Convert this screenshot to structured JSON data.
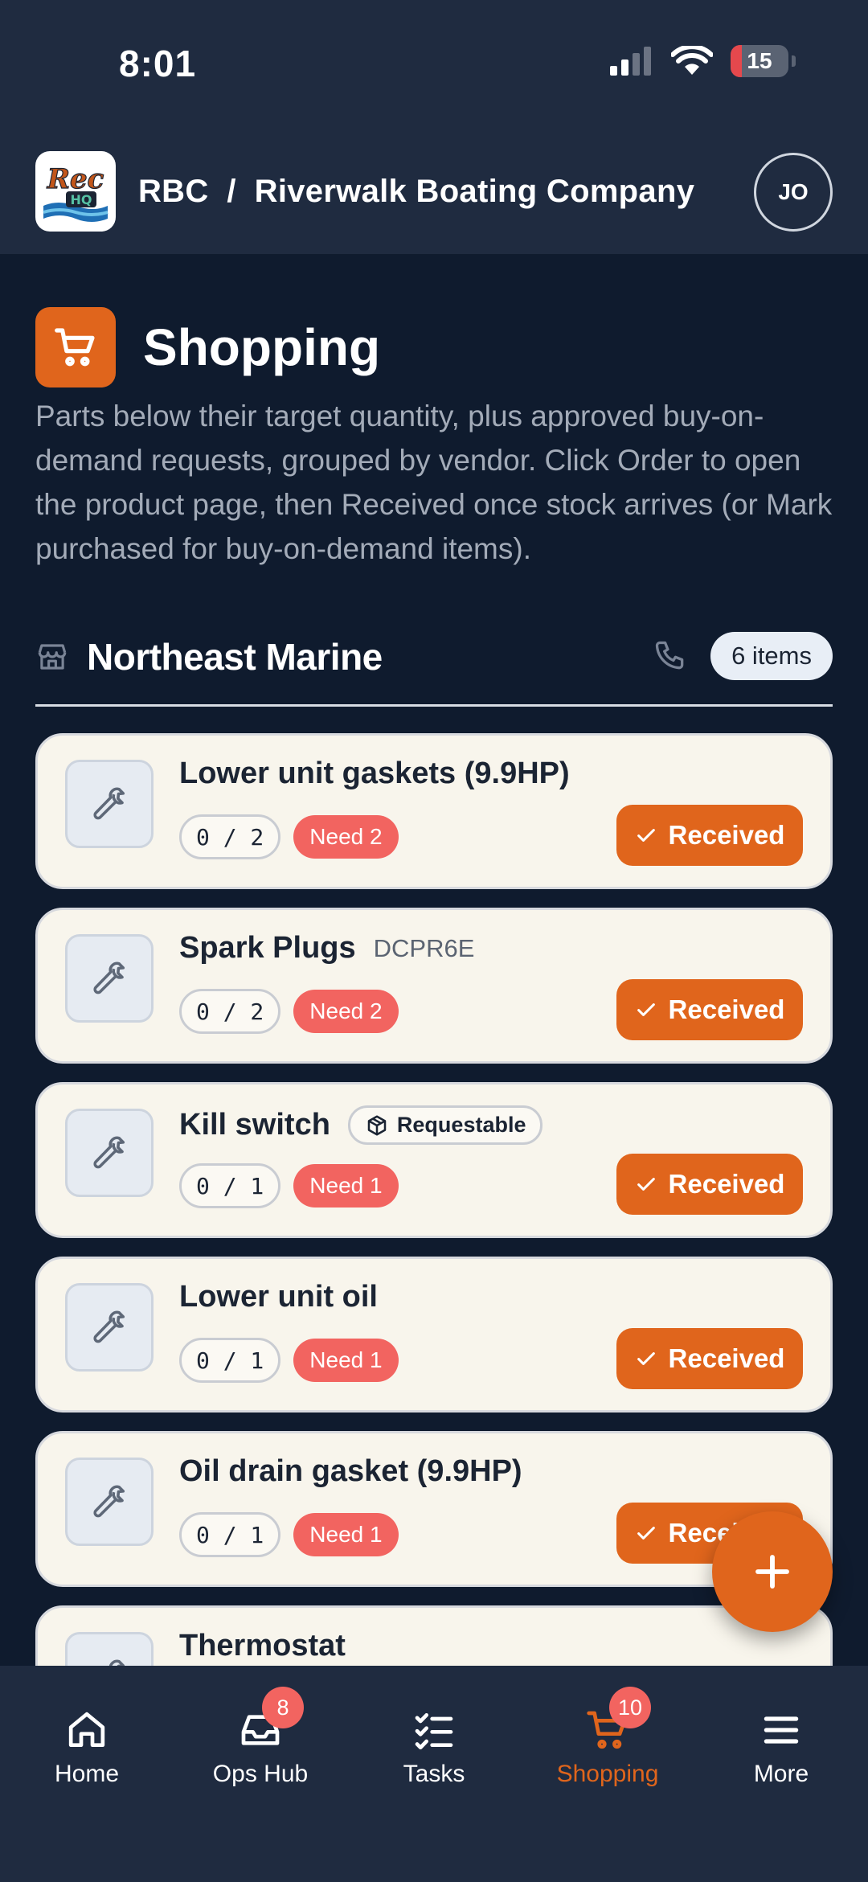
{
  "status_bar": {
    "time": "8:01",
    "battery": "15"
  },
  "header": {
    "logo_text_top": "Rec",
    "logo_text_bottom": "HQ",
    "org_label": "RBC  /  Riverwalk Boating Company",
    "avatar_initials": "JO"
  },
  "page": {
    "title": "Shopping",
    "description": "Parts below their target quantity, plus approved buy-on-demand requests, grouped by vendor. Click Order to open the product page, then Received once stock arrives (or Mark purchased for buy-on-demand items)."
  },
  "vendor": {
    "name": "Northeast Marine",
    "count_label": "6 items"
  },
  "items": [
    {
      "name": "Lower unit gaskets (9.9HP)",
      "sku": "",
      "badge": "",
      "qty": "0 / 2",
      "need": "Need 2",
      "action": "Received"
    },
    {
      "name": "Spark Plugs",
      "sku": "DCPR6E",
      "badge": "",
      "qty": "0 / 2",
      "need": "Need 2",
      "action": "Received"
    },
    {
      "name": "Kill switch",
      "sku": "",
      "badge": "Requestable",
      "qty": "0 / 1",
      "need": "Need 1",
      "action": "Received"
    },
    {
      "name": "Lower unit oil",
      "sku": "",
      "badge": "",
      "qty": "0 / 1",
      "need": "Need 1",
      "action": "Received"
    },
    {
      "name": "Oil drain gasket (9.9HP)",
      "sku": "",
      "badge": "",
      "qty": "0 / 1",
      "need": "Need 1",
      "action": "Received"
    },
    {
      "name": "Thermostat",
      "sku": "",
      "badge": "",
      "qty": "",
      "need": "",
      "action": ""
    }
  ],
  "bottom_nav": [
    {
      "label": "Home",
      "icon": "home-icon",
      "badge": ""
    },
    {
      "label": "Ops Hub",
      "icon": "inbox-icon",
      "badge": "8"
    },
    {
      "label": "Tasks",
      "icon": "checklist-icon",
      "badge": ""
    },
    {
      "label": "Shopping",
      "icon": "cart-icon",
      "badge": "10",
      "active": true
    },
    {
      "label": "More",
      "icon": "menu-icon",
      "badge": ""
    }
  ],
  "colors": {
    "accent": "#e0651c",
    "need_red": "#f26460",
    "background": "#0f1b2e",
    "header": "#1f2b40",
    "card": "#f8f5ec"
  }
}
